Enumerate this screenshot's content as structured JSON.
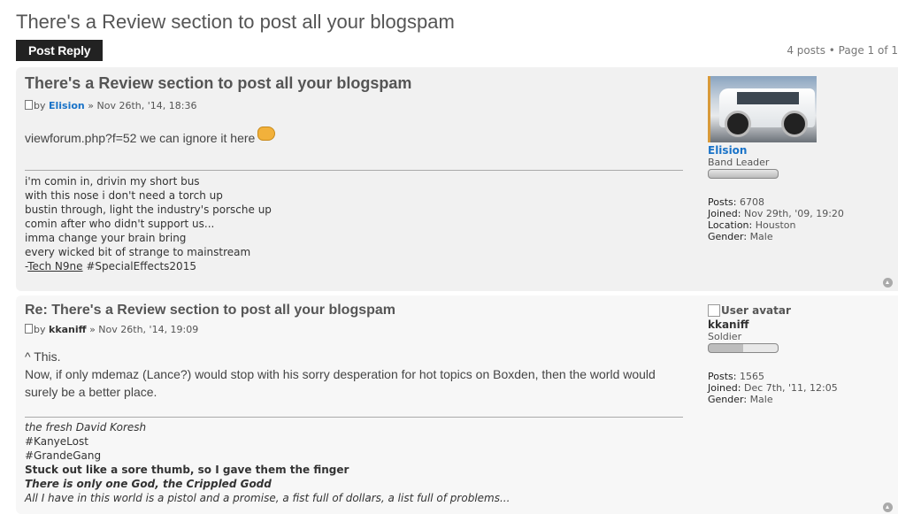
{
  "topic": {
    "title": "There's a Review section to post all your blogspam",
    "post_reply_label": "Post Reply",
    "pagination": "4 posts • Page 1 of 1"
  },
  "posts": [
    {
      "title": "There's a Review section to post all your blogspam",
      "by": "by",
      "author": "Elision",
      "date": "» Nov 26th, '14, 18:36",
      "content": [
        "viewforum.php?f=52 we can ignore it here"
      ],
      "signature": [
        "i'm comin in, drivin my short bus",
        "with this nose i don't need a torch up",
        "bustin through, light the industry's porsche up",
        "comin after who didn't support us...",
        "imma change your brain bring",
        "every wicked bit of strange to mainstream"
      ],
      "sig_dash": "-",
      "sig_link": "Tech N9ne",
      "sig_tag": " #SpecialEffects2015",
      "profile": {
        "name": "Elision",
        "rank": "Band Leader",
        "posts_label": "Posts:",
        "posts": "6708",
        "joined_label": "Joined:",
        "joined": "Nov 29th, '09, 19:20",
        "location_label": "Location:",
        "location": "Houston",
        "gender_label": "Gender:",
        "gender": "Male"
      }
    },
    {
      "title": "Re: There's a Review section to post all your blogspam",
      "by": "by",
      "author": "kkaniff",
      "date": "» Nov 26th, '14, 19:09",
      "content": [
        "^ This.",
        "Now, if only mdemaz (Lance?) would stop with his sorry desperation for hot topics on Boxden, then the world would surely be a better place."
      ],
      "signature": [
        "the fresh David Koresh",
        "#KanyeLost",
        "#GrandeGang",
        "Stuck out like a sore thumb, so I gave them the finger",
        "There is only one God, the Crippled Godd",
        "All I have in this world is a pistol and a promise, a fist full of dollars, a list full of problems..."
      ],
      "profile": {
        "avatar_alt": "User avatar",
        "name": "kkaniff",
        "rank": "Soldier",
        "posts_label": "Posts:",
        "posts": "1565",
        "joined_label": "Joined:",
        "joined": "Dec 7th, '11, 12:05",
        "gender_label": "Gender:",
        "gender": "Male"
      }
    }
  ],
  "icons": [
    "post-icon",
    "smiley-icon",
    "back-to-top-icon",
    "broken-image-icon"
  ]
}
